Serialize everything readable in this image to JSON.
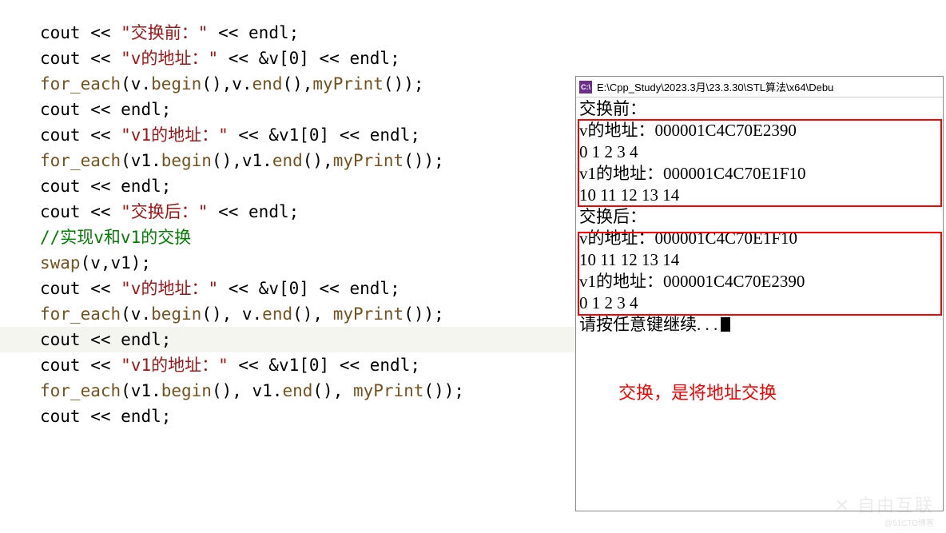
{
  "code": {
    "l1_cout": "cout",
    "l1_op": " << ",
    "l1_str": "\"交换前：\"",
    "l1_endl": "endl",
    "l2_cout": "cout",
    "l2_str": "\"v的地址：\"",
    "l2_amp": " << &",
    "l2_v": "v",
    "l2_idx": "[0] << ",
    "l2_endl": "endl",
    "l3_foreach": "for_each",
    "l3_args_a": "(v.",
    "l3_begin": "begin",
    "l3_pcommav": "(),v.",
    "l3_end": "end",
    "l3_pcomma": "(),",
    "l3_myprint": "myPrint",
    "l3_close": "());",
    "l4_cout": "cout",
    "l4_endl": "endl",
    "l5_cout": "cout",
    "l5_str": "\"v1的地址：\"",
    "l5_amp": " << &",
    "l5_v1": "v1",
    "l5_idx": "[0] << ",
    "l5_endl": "endl",
    "l6_foreach": "for_each",
    "l6_args_a": "(v1.",
    "l6_begin": "begin",
    "l6_pcommav": "(),v1.",
    "l6_end": "end",
    "l6_pcomma": "(),",
    "l6_myprint": "myPrint",
    "l6_close": "());",
    "l7_cout": "cout",
    "l7_endl": "endl",
    "l9_cout": "cout",
    "l9_str": "\"交换后：\"",
    "l9_endl": "endl",
    "l11_comment": "//实现v和v1的交换",
    "l12_swap": "swap",
    "l12_args": "(v,v1);",
    "l14_cout": "cout",
    "l14_str": "\"v的地址：\"",
    "l14_amp": " << &",
    "l14_v": "v",
    "l14_idx": "[0] << ",
    "l14_endl": "endl",
    "l15_foreach": "for_each",
    "l15_args_a": "(v.",
    "l15_begin": "begin",
    "l15_pcv": "(), v.",
    "l15_end": "end",
    "l15_pc": "(), ",
    "l15_myprint": "myPrint",
    "l15_close": "());",
    "l16_cout": "cout",
    "l16_endl": "endl",
    "l17_cout": "cout",
    "l17_str": "\"v1的地址：\"",
    "l17_amp": " << &",
    "l17_v1": "v1",
    "l17_idx": "[0] << ",
    "l17_endl": "endl",
    "l18_foreach": "for_each",
    "l18_args_a": "(v1.",
    "l18_begin": "begin",
    "l18_pcv": "(), v1.",
    "l18_end": "end",
    "l18_pc": "(), ",
    "l18_myprint": "myPrint",
    "l18_close": "());",
    "l19_cout": "cout",
    "l19_endl": "endl",
    "semicolon": ";",
    "ll_op": " << "
  },
  "console": {
    "icon": "C:\\",
    "title": "E:\\Cpp_Study\\2023.3月\\23.3.30\\STL算法\\x64\\Debu",
    "lines": [
      "交换前：",
      "v的地址：000001C4C70E2390",
      "0 1 2 3 4",
      "v1的地址：000001C4C70E1F10",
      "10 11 12 13 14",
      "交换后：",
      "v的地址：000001C4C70E1F10",
      "10 11 12 13 14",
      "v1的地址：000001C4C70E2390",
      "0 1 2 3 4",
      "请按任意键继续. . ."
    ],
    "annotation": "交换，是将地址交换"
  },
  "watermark": {
    "main": "✕ 自由互联",
    "sub": "@51CTO博客"
  }
}
